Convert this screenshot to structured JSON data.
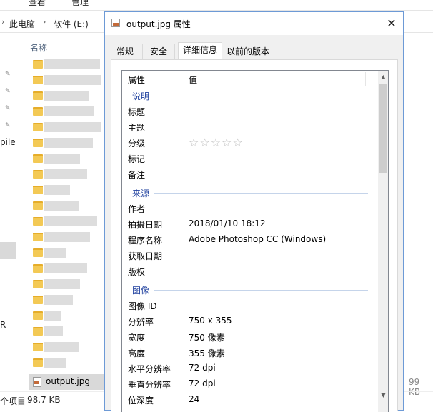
{
  "explorer": {
    "ribbon_tabs": [
      "查看",
      "管理"
    ],
    "breadcrumbs": [
      "此电脑",
      "软件 (E:)"
    ],
    "column_name": "名称",
    "nav_partial_text": "pile",
    "nav_partial_text2": "R",
    "selected_file": "output.jpg",
    "right_size": "99 KB",
    "status_count": "个项目",
    "status_size": "98.7 KB"
  },
  "dialog": {
    "title": "output.jpg 属性",
    "close_symbol": "✕",
    "tabs": [
      "常规",
      "安全",
      "详细信息",
      "以前的版本"
    ],
    "active_tab": "详细信息",
    "columns": {
      "property": "属性",
      "value": "值"
    },
    "groups": {
      "description": "说明",
      "origin": "来源",
      "image": "图像"
    },
    "description_rows": [
      {
        "label": "标题",
        "value": ""
      },
      {
        "label": "主题",
        "value": ""
      },
      {
        "label": "分级",
        "value": "☆☆☆☆☆"
      },
      {
        "label": "标记",
        "value": ""
      },
      {
        "label": "备注",
        "value": ""
      }
    ],
    "origin_rows": [
      {
        "label": "作者",
        "value": ""
      },
      {
        "label": "拍摄日期",
        "value": "2018/01/10 18:12"
      },
      {
        "label": "程序名称",
        "value": "Adobe Photoshop CC (Windows)"
      },
      {
        "label": "获取日期",
        "value": ""
      },
      {
        "label": "版权",
        "value": ""
      }
    ],
    "image_rows": [
      {
        "label": "图像 ID",
        "value": ""
      },
      {
        "label": "分辨率",
        "value": "750 x 355"
      },
      {
        "label": "宽度",
        "value": "750 像素"
      },
      {
        "label": "高度",
        "value": "355 像素"
      },
      {
        "label": "水平分辨率",
        "value": "72 dpi"
      },
      {
        "label": "垂直分辨率",
        "value": "72 dpi"
      },
      {
        "label": "位深度",
        "value": "24"
      }
    ],
    "scroll_up": "▲",
    "scroll_down": "▼"
  }
}
